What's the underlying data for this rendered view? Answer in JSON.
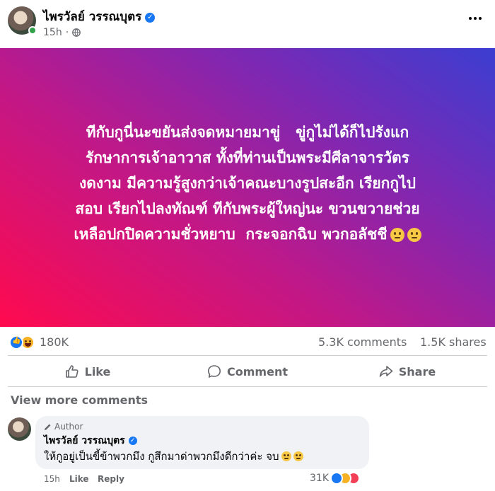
{
  "post": {
    "author_name": "ไพรวัลย์ วรรณบุตร",
    "verified_icon": "verified-badge-icon",
    "time": "15h",
    "separator": "·",
    "privacy_icon": "globe-icon",
    "more_icon": "more-options-icon",
    "banner_lines": [
      "ทีกับกูนี่นะขยันส่งจดหมายมาขู่ ￼ ￼ ขู่กูไม่ได้ก็ไปรังแก",
      "รักษาการเจ้าอาวาส ￼ทั้งที่ท่านเป็นพระมีศีลาจารวัตร",
      "งดงาม มีความรู้￼สูงกว่าเจ้าคณะบางรูปสะอีก เรียกกูไป",
      "สอบ เรียกไปลงทัณฑ์ ทีกับพระผู้ใหญ่นะ ขวนขวายช่วย",
      "เหลือปกปิดความชั่วหยาบ ￼ กระจอกฉิบ พวกอลัชชี"
    ],
    "banner_colors": [
      "#ff0a4e",
      "#c01888",
      "#7d28b3",
      "#3b3ed1"
    ]
  },
  "stats": {
    "reactions": [
      "like",
      "haha"
    ],
    "reaction_count": "180K",
    "comments": "5.3K comments",
    "shares": "1.5K shares"
  },
  "actions": {
    "like": "Like",
    "comment": "Comment",
    "share": "Share"
  },
  "comments": {
    "view_more": "View more comments",
    "items": [
      {
        "badge": "Author",
        "name": "ไพรวัลย์ วรรณบุตร",
        "text": "ให้กูอยู่เป็นขี้ข้าพวกมึง กูสึกมาด่าพวกมึงดีกว่าค่ะ จบ",
        "time": "15h",
        "like": "Like",
        "reply": "Reply",
        "reaction_count": "31K",
        "reactions": [
          "like",
          "haha",
          "love"
        ]
      }
    ]
  },
  "colors": {
    "accent": "#1877f2",
    "secondary_text": "#65676b",
    "bubble_bg": "#f0f2f5"
  }
}
